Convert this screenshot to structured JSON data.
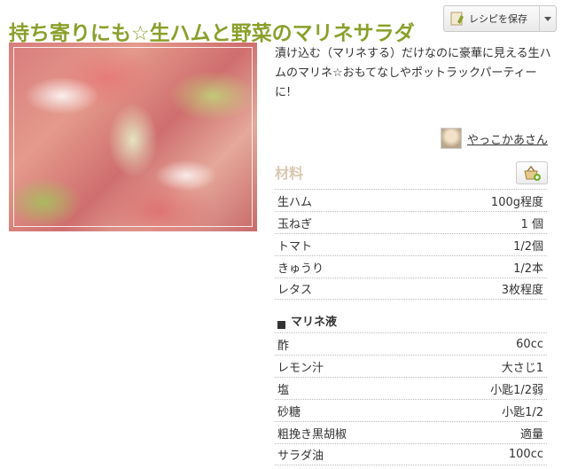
{
  "recipe": {
    "title": "持ち寄りにも☆生ハムと野菜のマリネサラダ",
    "description": "漬け込む（マリネする）だけなのに豪華に見える生ハムのマリネ☆おもてなしやポットラックパーティーに!",
    "author": "やっこかあさん"
  },
  "save": {
    "label": "レシピを保存"
  },
  "ingredients": {
    "heading": "材料",
    "items": [
      {
        "name": "生ハム",
        "qty": "100g程度"
      },
      {
        "name": "玉ねぎ",
        "qty": "1 個"
      },
      {
        "name": "トマト",
        "qty": "1/2個"
      },
      {
        "name": "きゅうり",
        "qty": "1/2本"
      },
      {
        "name": "レタス",
        "qty": "3枚程度"
      }
    ],
    "group_label": "マリネ液",
    "group_items": [
      {
        "name": "酢",
        "qty": "60cc"
      },
      {
        "name": "レモン汁",
        "qty": "大さじ1"
      },
      {
        "name": "塩",
        "qty": "小匙1/2弱"
      },
      {
        "name": "砂糖",
        "qty": "小匙1/2"
      },
      {
        "name": "粗挽き黒胡椒",
        "qty": "適量"
      },
      {
        "name": "サラダ油",
        "qty": "100cc"
      }
    ]
  },
  "icons": {
    "save_icon": "save-recipe-icon",
    "basket_icon": "shopping-basket-add-icon",
    "dropdown": "chevron-down-icon"
  },
  "colors": {
    "title": "#8aa02c",
    "heading": "#d9c9b2"
  }
}
